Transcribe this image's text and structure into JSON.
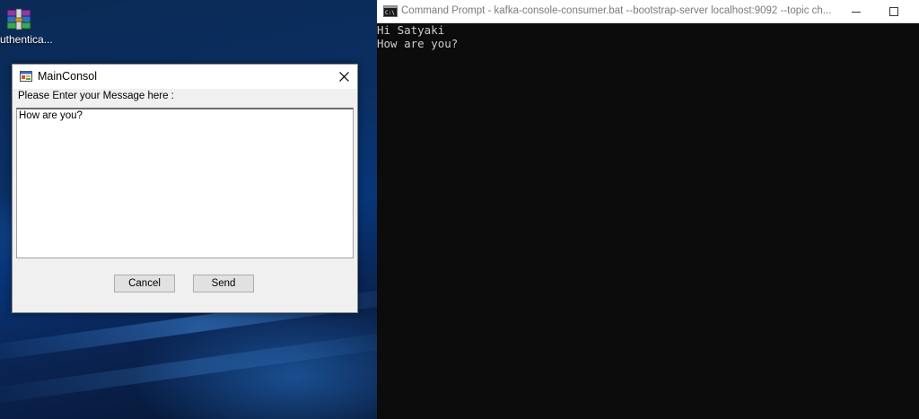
{
  "desktop": {
    "icon": {
      "label": "uthentica...",
      "icon_name": "winrar-archive-icon"
    }
  },
  "dialog": {
    "title": "MainConsol",
    "prompt": "Please Enter your Message here :",
    "message_value": "How are you?",
    "cancel_label": "Cancel",
    "send_label": "Send"
  },
  "console": {
    "title": "Command Prompt - kafka-console-consumer.bat  --bootstrap-server localhost:9092 --topic ch...",
    "lines": [
      "Hi Satyaki",
      "How are you?"
    ]
  },
  "colors": {
    "console_bg": "#0c0c0c",
    "console_text": "#cccccc",
    "dialog_bg": "#f0f0f0",
    "desktop_blue": "#0a2f63"
  }
}
